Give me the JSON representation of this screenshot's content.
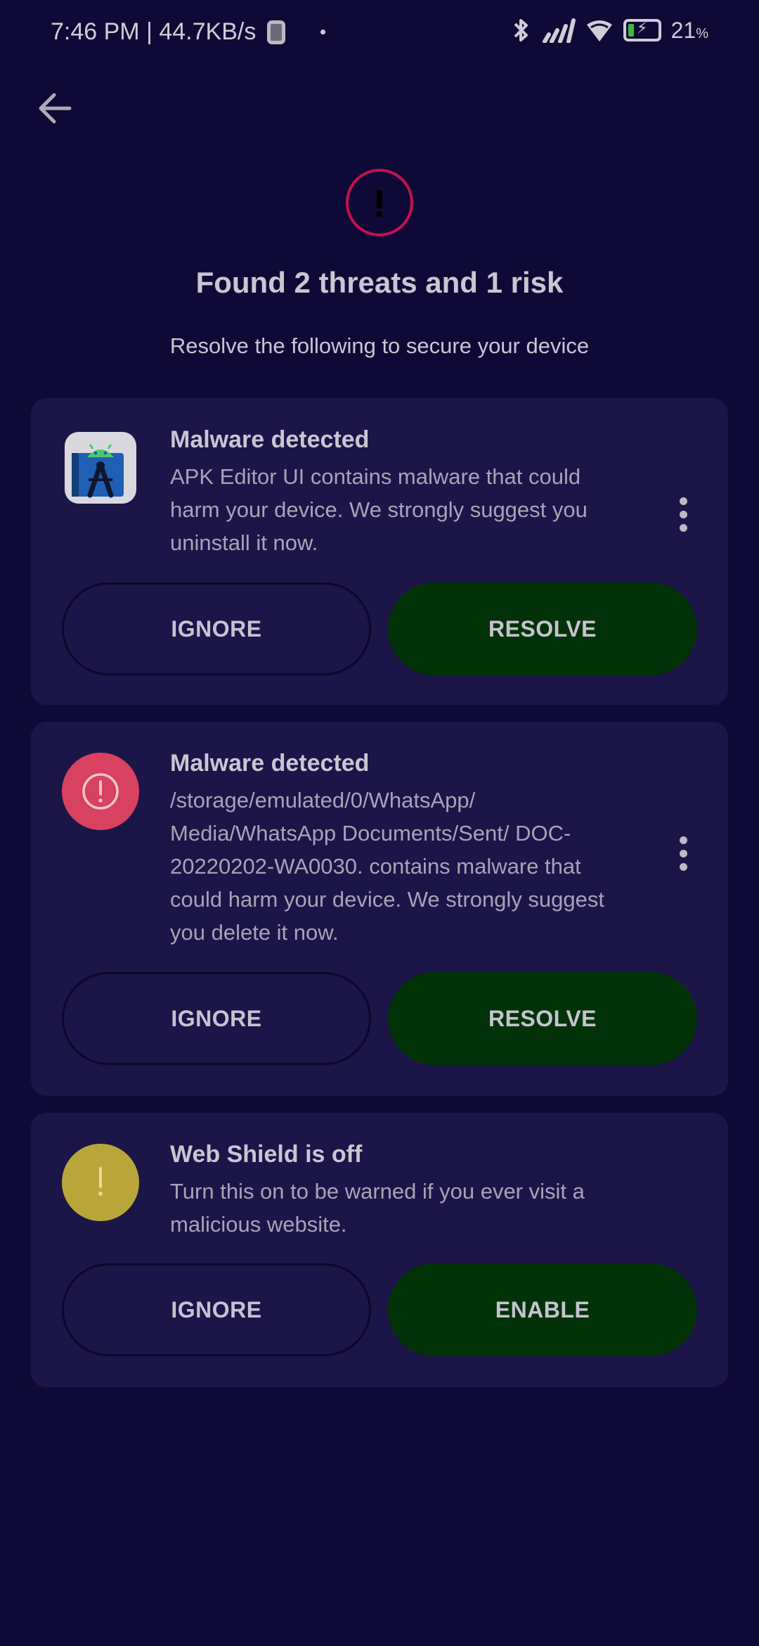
{
  "status_bar": {
    "time_speed": "7:46 PM | 44.7KB/s",
    "battery_pct": "21",
    "battery_unit": "%",
    "battery_level": 0.21
  },
  "header": {
    "title": "Found 2 threats and 1 risk",
    "subtitle": "Resolve the following to secure your device",
    "alert_glyph": "!"
  },
  "cards": [
    {
      "icon": "apk-editor-app-icon",
      "title": "Malware detected",
      "description": "APK Editor UI contains malware that could harm your device. We strongly suggest you uninstall it now.",
      "ignore_label": "IGNORE",
      "action_label": "RESOLVE"
    },
    {
      "icon": "alert-circle-icon",
      "icon_color": "#d8415f",
      "title": "Malware detected",
      "description": "/storage/emulated/0/WhatsApp/ Media/WhatsApp Documents/Sent/ DOC-20220202-WA0030. contains malware that could harm your device. We strongly suggest you delete it now.",
      "ignore_label": "IGNORE",
      "action_label": "RESOLVE"
    },
    {
      "icon": "warning-circle-icon",
      "icon_color": "#b9a63a",
      "title": "Web Shield is off",
      "description": "Turn this on to be warned if you ever visit a malicious website.",
      "ignore_label": "IGNORE",
      "action_label": "ENABLE"
    }
  ],
  "colors": {
    "background": "#0f0a35",
    "card": "#1b1548",
    "action_button": "#013208",
    "alert_ring": "#c2124f"
  }
}
